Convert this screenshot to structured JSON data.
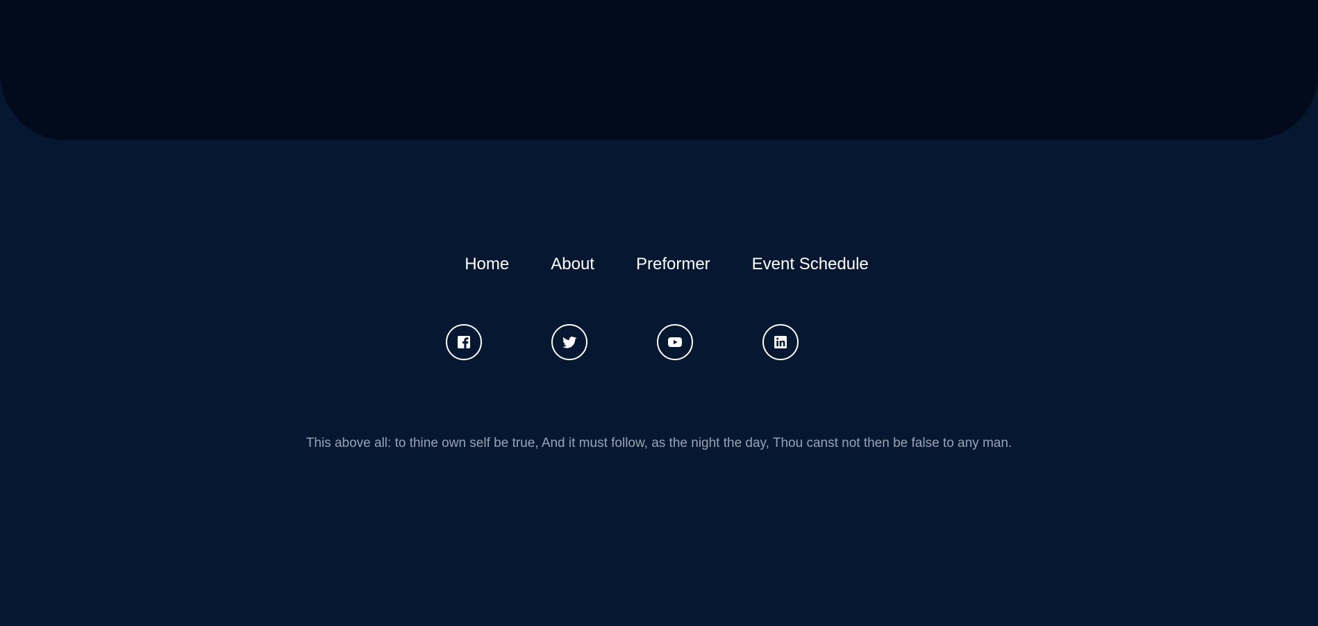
{
  "nav": {
    "items": [
      {
        "label": "Home"
      },
      {
        "label": "About"
      },
      {
        "label": "Preformer"
      },
      {
        "label": "Event Schedule"
      }
    ]
  },
  "social": {
    "items": [
      {
        "icon": "facebook-icon"
      },
      {
        "icon": "twitter-icon"
      },
      {
        "icon": "youtube-icon"
      },
      {
        "icon": "linkedin-icon"
      }
    ]
  },
  "footer": {
    "quote": "This above all: to thine own self be true, And it must follow, as the night the day, Thou canst not then be false to any man."
  },
  "colors": {
    "background": "#061731",
    "top_panel": "#020b1b",
    "text": "#ffffff",
    "muted_text": "#9aa3b2"
  }
}
